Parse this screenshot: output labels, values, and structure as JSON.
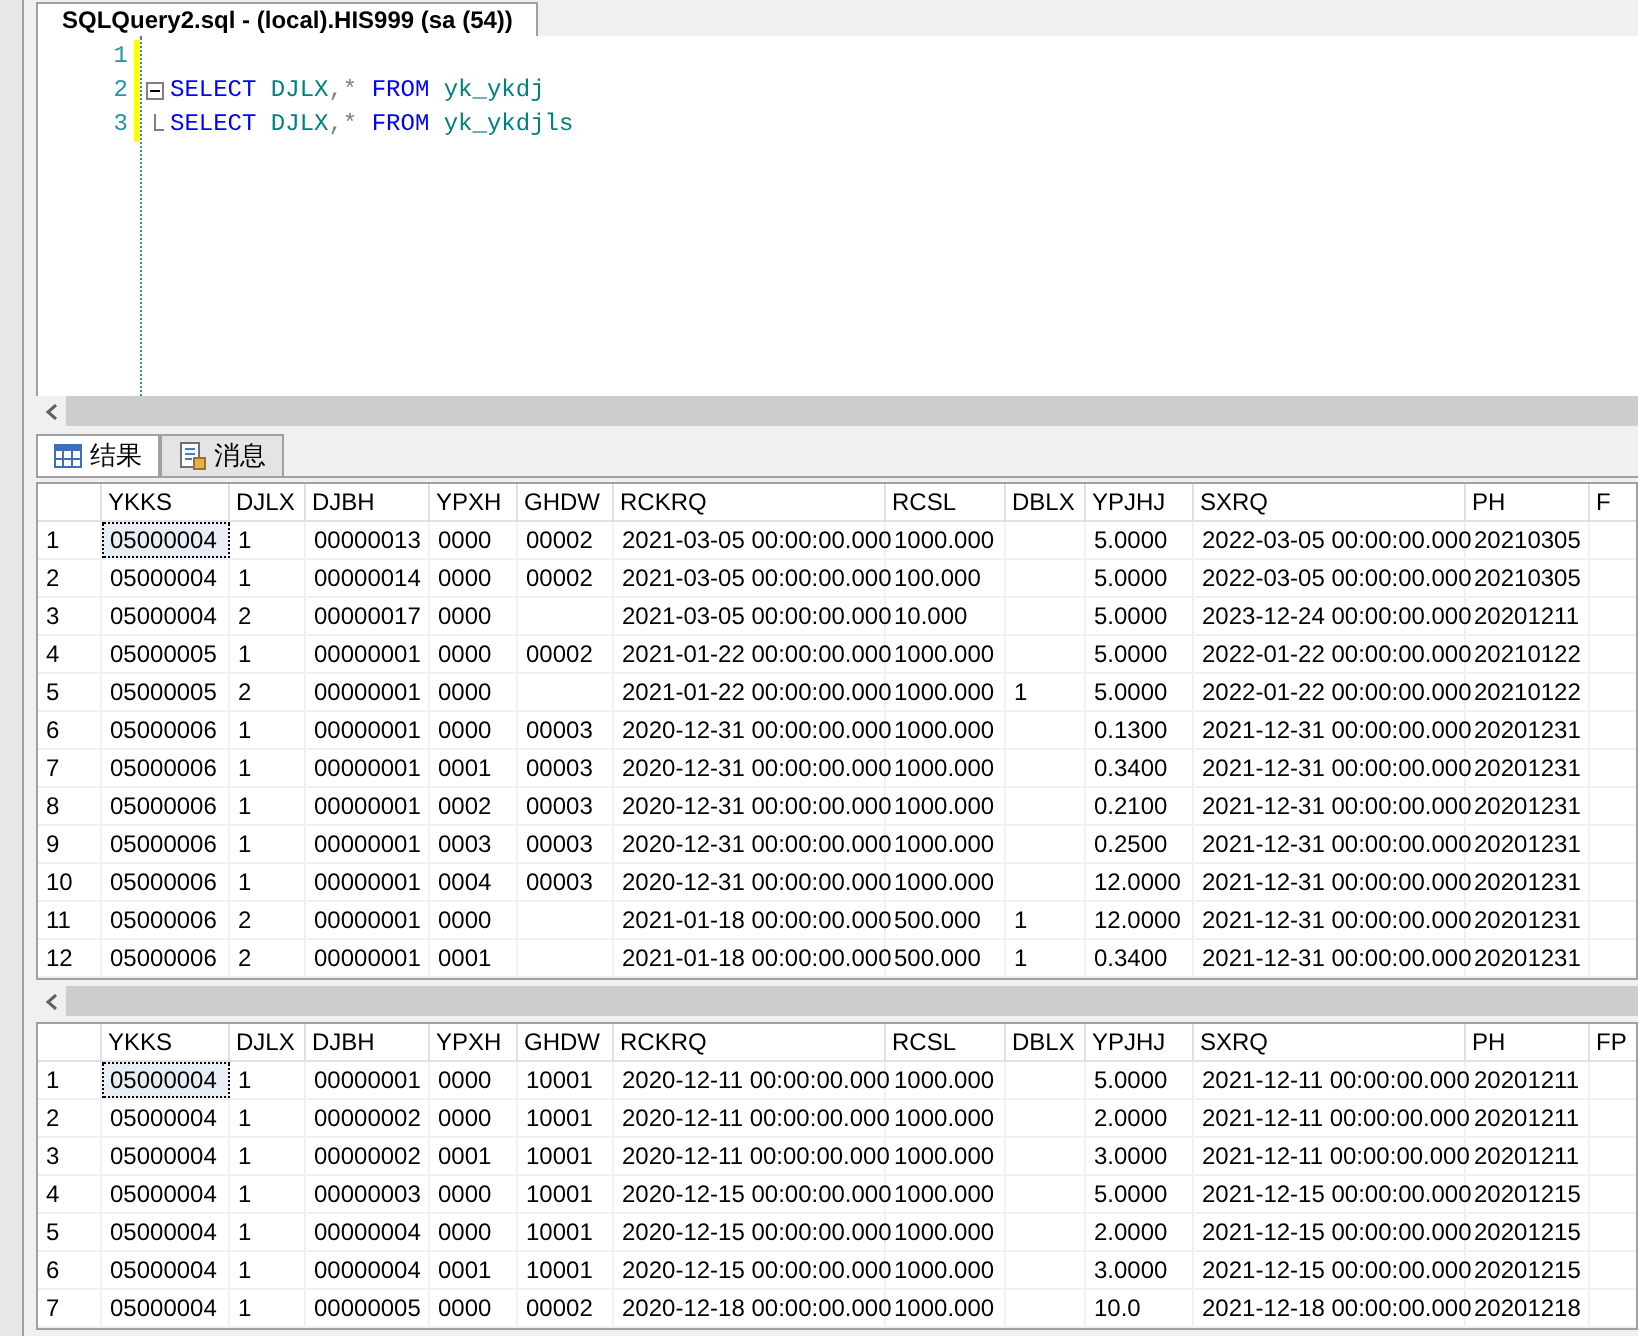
{
  "editor_tab": {
    "title": "SQLQuery2.sql - (local).HIS999 (sa (54))"
  },
  "editor": {
    "lines": [
      {
        "number": "1",
        "kind": "blank"
      },
      {
        "number": "2",
        "kind": "fold-start",
        "tokens": [
          {
            "kind": "keyword",
            "text": "SELECT"
          },
          {
            "kind": "identifier",
            "text": " DJLX"
          },
          {
            "kind": "operator",
            "text": ",*"
          },
          {
            "kind": "keyword",
            "text": " FROM"
          },
          {
            "kind": "identifier",
            "text": " yk_ykdj"
          }
        ]
      },
      {
        "number": "3",
        "kind": "fold-end",
        "tokens": [
          {
            "kind": "keyword",
            "text": "SELECT"
          },
          {
            "kind": "identifier",
            "text": " DJLX"
          },
          {
            "kind": "operator",
            "text": ",*"
          },
          {
            "kind": "keyword",
            "text": " FROM"
          },
          {
            "kind": "identifier",
            "text": " yk_ykdjls"
          }
        ]
      }
    ]
  },
  "result_tabs": [
    {
      "label": "结果",
      "kind": "grid",
      "selected": true
    },
    {
      "label": "消息",
      "kind": "messages",
      "selected": false
    }
  ],
  "grids": [
    {
      "columns": [
        "",
        "YKKS",
        "DJLX",
        "DJBH",
        "YPXH",
        "GHDW",
        "RCKRQ",
        "RCSL",
        "DBLX",
        "YPJHJ",
        "SXRQ",
        "PH",
        "F"
      ],
      "rows": [
        {
          "selected": true,
          "cells": [
            "1",
            "05000004",
            "1",
            "00000013",
            "0000",
            "00002",
            "2021-03-05 00:00:00.000",
            "1000.000",
            null,
            "5.0000",
            "2022-03-05 00:00:00.000",
            "20210305",
            null
          ]
        },
        {
          "selected": false,
          "cells": [
            "2",
            "05000004",
            "1",
            "00000014",
            "0000",
            "00002",
            "2021-03-05 00:00:00.000",
            "100.000",
            null,
            "5.0000",
            "2022-03-05 00:00:00.000",
            "20210305",
            null
          ]
        },
        {
          "selected": false,
          "cells": [
            "3",
            "05000004",
            "2",
            "00000017",
            "0000",
            null,
            "2021-03-05 00:00:00.000",
            "10.000",
            null,
            "5.0000",
            "2023-12-24 00:00:00.000",
            "20201211",
            null
          ]
        },
        {
          "selected": false,
          "cells": [
            "4",
            "05000005",
            "1",
            "00000001",
            "0000",
            "00002",
            "2021-01-22 00:00:00.000",
            "1000.000",
            null,
            "5.0000",
            "2022-01-22 00:00:00.000",
            "20210122",
            null
          ]
        },
        {
          "selected": false,
          "cells": [
            "5",
            "05000005",
            "2",
            "00000001",
            "0000",
            null,
            "2021-01-22 00:00:00.000",
            "1000.000",
            "1",
            "5.0000",
            "2022-01-22 00:00:00.000",
            "20210122",
            null
          ]
        },
        {
          "selected": false,
          "cells": [
            "6",
            "05000006",
            "1",
            "00000001",
            "0000",
            "00003",
            "2020-12-31 00:00:00.000",
            "1000.000",
            null,
            "0.1300",
            "2021-12-31 00:00:00.000",
            "20201231",
            null
          ]
        },
        {
          "selected": false,
          "cells": [
            "7",
            "05000006",
            "1",
            "00000001",
            "0001",
            "00003",
            "2020-12-31 00:00:00.000",
            "1000.000",
            null,
            "0.3400",
            "2021-12-31 00:00:00.000",
            "20201231",
            null
          ]
        },
        {
          "selected": false,
          "cells": [
            "8",
            "05000006",
            "1",
            "00000001",
            "0002",
            "00003",
            "2020-12-31 00:00:00.000",
            "1000.000",
            null,
            "0.2100",
            "2021-12-31 00:00:00.000",
            "20201231",
            null
          ]
        },
        {
          "selected": false,
          "cells": [
            "9",
            "05000006",
            "1",
            "00000001",
            "0003",
            "00003",
            "2020-12-31 00:00:00.000",
            "1000.000",
            null,
            "0.2500",
            "2021-12-31 00:00:00.000",
            "20201231",
            null
          ]
        },
        {
          "selected": false,
          "cells": [
            "10",
            "05000006",
            "1",
            "00000001",
            "0004",
            "00003",
            "2020-12-31 00:00:00.000",
            "1000.000",
            null,
            "12.0000",
            "2021-12-31 00:00:00.000",
            "20201231",
            null
          ]
        },
        {
          "selected": false,
          "cells": [
            "11",
            "05000006",
            "2",
            "00000001",
            "0000",
            null,
            "2021-01-18 00:00:00.000",
            "500.000",
            "1",
            "12.0000",
            "2021-12-31 00:00:00.000",
            "20201231",
            null
          ]
        },
        {
          "selected": false,
          "cells": [
            "12",
            "05000006",
            "2",
            "00000001",
            "0001",
            null,
            "2021-01-18 00:00:00.000",
            "500.000",
            "1",
            "0.3400",
            "2021-12-31 00:00:00.000",
            "20201231",
            null
          ]
        }
      ]
    },
    {
      "columns": [
        "",
        "YKKS",
        "DJLX",
        "DJBH",
        "YPXH",
        "GHDW",
        "RCKRQ",
        "RCSL",
        "DBLX",
        "YPJHJ",
        "SXRQ",
        "PH",
        "FP"
      ],
      "rows": [
        {
          "selected": true,
          "cells": [
            "1",
            "05000004",
            "1",
            "00000001",
            "0000",
            "10001",
            "2020-12-11 00:00:00.000",
            "1000.000",
            null,
            "5.0000",
            "2021-12-11 00:00:00.000",
            "20201211",
            null
          ]
        },
        {
          "selected": false,
          "cells": [
            "2",
            "05000004",
            "1",
            "00000002",
            "0000",
            "10001",
            "2020-12-11 00:00:00.000",
            "1000.000",
            null,
            "2.0000",
            "2021-12-11 00:00:00.000",
            "20201211",
            null
          ]
        },
        {
          "selected": false,
          "cells": [
            "3",
            "05000004",
            "1",
            "00000002",
            "0001",
            "10001",
            "2020-12-11 00:00:00.000",
            "1000.000",
            null,
            "3.0000",
            "2021-12-11 00:00:00.000",
            "20201211",
            null
          ]
        },
        {
          "selected": false,
          "cells": [
            "4",
            "05000004",
            "1",
            "00000003",
            "0000",
            "10001",
            "2020-12-15 00:00:00.000",
            "1000.000",
            null,
            "5.0000",
            "2021-12-15 00:00:00.000",
            "20201215",
            null
          ]
        },
        {
          "selected": false,
          "cells": [
            "5",
            "05000004",
            "1",
            "00000004",
            "0000",
            "10001",
            "2020-12-15 00:00:00.000",
            "1000.000",
            null,
            "2.0000",
            "2021-12-15 00:00:00.000",
            "20201215",
            null
          ]
        },
        {
          "selected": false,
          "cells": [
            "6",
            "05000004",
            "1",
            "00000004",
            "0001",
            "10001",
            "2020-12-15 00:00:00.000",
            "1000.000",
            null,
            "3.0000",
            "2021-12-15 00:00:00.000",
            "20201215",
            null
          ]
        },
        {
          "selected": false,
          "cells": [
            "7",
            "05000004",
            "1",
            "00000005",
            "0000",
            "00002",
            "2020-12-18 00:00:00.000",
            "1000.000",
            null,
            "10.0",
            "2021-12-18 00:00:00.000",
            "20201218",
            null
          ]
        }
      ]
    }
  ]
}
